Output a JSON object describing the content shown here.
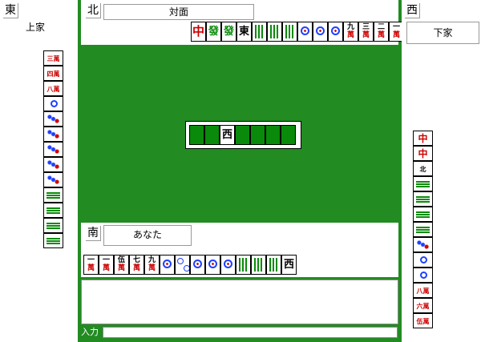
{
  "players": {
    "west": {
      "wind": "東",
      "name": "上家"
    },
    "north": {
      "wind": "北",
      "name": "対面"
    },
    "east": {
      "wind": "西",
      "name": "下家"
    },
    "south": {
      "wind": "南",
      "name": "あなた"
    }
  },
  "input": {
    "label": "入力"
  },
  "dora": {
    "tile": "西"
  },
  "north_discards": [
    {
      "type": "chun",
      "text": "中"
    },
    {
      "type": "hatsu",
      "text": "發"
    },
    {
      "type": "hatsu",
      "text": "發"
    },
    {
      "type": "wind-t",
      "text": "東"
    },
    {
      "type": "sou",
      "text": ""
    },
    {
      "type": "sou",
      "text": ""
    },
    {
      "type": "sou",
      "text": ""
    },
    {
      "type": "pin",
      "text": ""
    },
    {
      "type": "pin",
      "text": ""
    },
    {
      "type": "pin",
      "text": ""
    },
    {
      "type": "man",
      "top": "九",
      "bot": "萬"
    },
    {
      "type": "man",
      "top": "三",
      "bot": "萬"
    },
    {
      "type": "man",
      "top": "二",
      "bot": "萬"
    },
    {
      "type": "man",
      "top": "一",
      "bot": "萬"
    }
  ],
  "south_hand": [
    {
      "type": "man",
      "top": "一",
      "bot": "萬"
    },
    {
      "type": "man",
      "top": "一",
      "bot": "萬"
    },
    {
      "type": "man",
      "top": "伍",
      "bot": "萬"
    },
    {
      "type": "man",
      "top": "七",
      "bot": "萬"
    },
    {
      "type": "man",
      "top": "九",
      "bot": "萬"
    },
    {
      "type": "pin",
      "text": ""
    },
    {
      "type": "pin2",
      "text": ""
    },
    {
      "type": "pin",
      "text": ""
    },
    {
      "type": "pin",
      "text": ""
    },
    {
      "type": "pin",
      "text": ""
    },
    {
      "type": "sou",
      "text": ""
    },
    {
      "type": "sou",
      "text": ""
    },
    {
      "type": "sou",
      "text": ""
    },
    {
      "type": "wind-t",
      "text": "西"
    }
  ],
  "west_hand": [
    {
      "type": "man",
      "text": "三萬"
    },
    {
      "type": "man",
      "text": "四萬"
    },
    {
      "type": "man",
      "text": "八萬"
    },
    {
      "type": "pin",
      "text": ""
    },
    {
      "type": "pin2",
      "text": ""
    },
    {
      "type": "pin2",
      "text": ""
    },
    {
      "type": "pin2",
      "text": ""
    },
    {
      "type": "pin2",
      "text": ""
    },
    {
      "type": "pin2",
      "text": ""
    },
    {
      "type": "sou",
      "text": ""
    },
    {
      "type": "sou",
      "text": ""
    },
    {
      "type": "sou",
      "text": ""
    },
    {
      "type": "sou",
      "text": ""
    }
  ],
  "east_hand": [
    {
      "type": "chun",
      "text": "中"
    },
    {
      "type": "chun",
      "text": "中"
    },
    {
      "type": "wind-t",
      "text": "北"
    },
    {
      "type": "sou",
      "text": ""
    },
    {
      "type": "sou",
      "text": ""
    },
    {
      "type": "sou",
      "text": ""
    },
    {
      "type": "sou",
      "text": ""
    },
    {
      "type": "pin2",
      "text": ""
    },
    {
      "type": "pin",
      "text": ""
    },
    {
      "type": "pin",
      "text": ""
    },
    {
      "type": "man",
      "text": "八萬"
    },
    {
      "type": "man",
      "text": "六萬"
    },
    {
      "type": "man",
      "text": "伍萬"
    }
  ]
}
